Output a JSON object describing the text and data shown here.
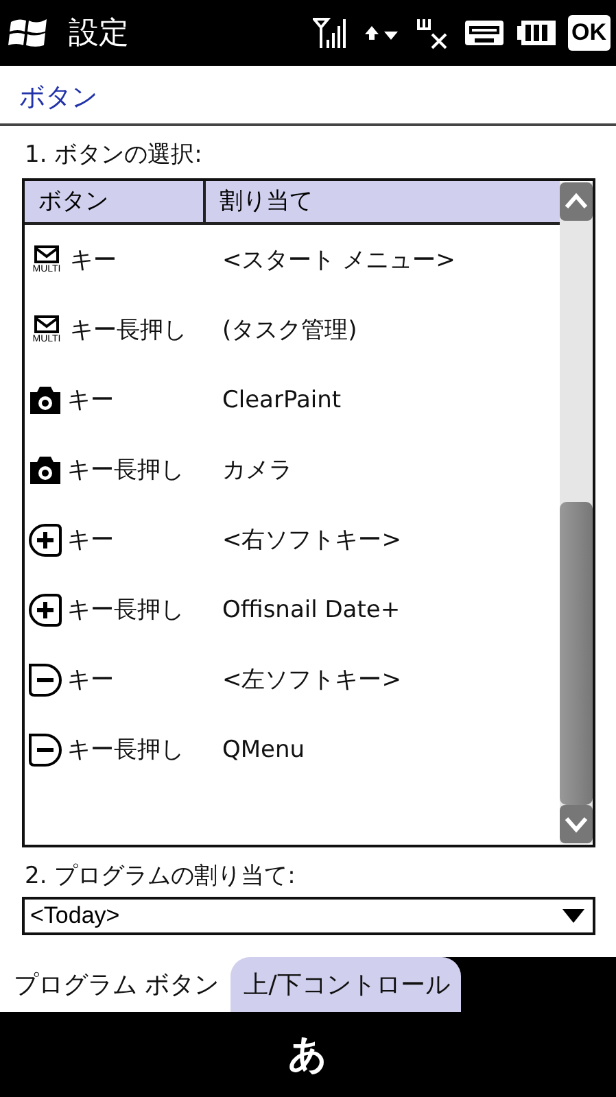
{
  "title_bar": {
    "title": "設定",
    "ok": "OK"
  },
  "page_header": {
    "title": "ボタン"
  },
  "section_1": {
    "label": "1. ボタンの選択:"
  },
  "button_list": {
    "columns": [
      "ボタン",
      "割り当て"
    ],
    "rows": [
      {
        "kind": "mail",
        "icon_label": "MULTI",
        "key": "キー",
        "assignment": "<スタート メニュー>"
      },
      {
        "kind": "mail",
        "icon_label": "MULTI",
        "key": "キー長押し",
        "assignment": "(タスク管理)"
      },
      {
        "kind": "camera",
        "key": "キー",
        "assignment": "ClearPaint"
      },
      {
        "kind": "camera",
        "key": "キー長押し",
        "assignment": "カメラ"
      },
      {
        "kind": "plus",
        "key": "キー",
        "assignment": "<右ソフトキー>"
      },
      {
        "kind": "plus",
        "key": "キー長押し",
        "assignment": "Offisnail Date+"
      },
      {
        "kind": "minus",
        "key": "キー",
        "assignment": "<左ソフトキー>"
      },
      {
        "kind": "minus",
        "key": "キー長押し",
        "assignment": "QMenu"
      }
    ]
  },
  "section_2": {
    "label": "2. プログラムの割り当て:",
    "dropdown": {
      "value": "<Today>"
    }
  },
  "tabs": [
    {
      "label": "プログラム ボタン",
      "selected": true
    },
    {
      "label": "上/下コントロール",
      "selected": false
    }
  ],
  "input_bar": {
    "mode": "あ"
  }
}
